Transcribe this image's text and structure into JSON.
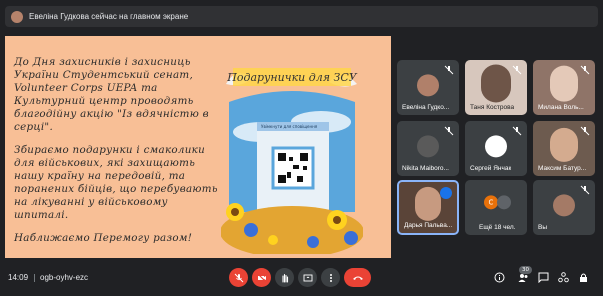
{
  "banner": {
    "text": "Евеліна Гудкова сейчас на главном экране"
  },
  "slide": {
    "paragraphs": [
      "До Дня захисників і захисниць України Студентський сенат, Volunteer Corps UEPA та Культурний центр проводять благодійну акцію \"Із вдячністю в серці\".",
      "Збираємо подарунки і смаколики для військових, які захищають нашу країну на передовій, та поранених бійців, що перебувають на лікуванні у військовому шпиталі.",
      "Наближаємо Перемогу разом!"
    ],
    "image_title": "Подарунички для ЗСУ",
    "phone_caption": "Увімкнути для сповіщення"
  },
  "participants": [
    {
      "name": "Евеліна Гудко...",
      "avatar_color": "#b0806a"
    },
    {
      "name": "Таня Кострова",
      "avatar_color": "#d7c7bd"
    },
    {
      "name": "Милана Воль...",
      "avatar_color": "#c4a79a"
    },
    {
      "name": "Nikita Maiboro...",
      "avatar_color": "#5a5a5a"
    },
    {
      "name": "Сергей Янчак",
      "avatar_color": "#ffffff"
    },
    {
      "name": "Максим Батур...",
      "avatar_color": "#8a6a52"
    },
    {
      "name": "Дарья Пальва...",
      "avatar_color": "#7a5a4a"
    },
    {
      "name": "Ещё 18 чел.",
      "avatar_color": "#e8710a",
      "initial": "С"
    },
    {
      "name": "Вы",
      "avatar_color": "#a47a66"
    }
  ],
  "bottom": {
    "time": "14:09",
    "separator": "|",
    "meeting_code": "ogb-oyhv-ezc",
    "participants_count": "30"
  },
  "colors": {
    "accent": "#8ab4f8",
    "danger": "#ea4335",
    "slide_bg": "#f8bf96"
  },
  "icons": [
    "mic-off-icon",
    "camera-off-icon",
    "raise-hand-icon",
    "present-icon",
    "more-icon",
    "end-call-icon",
    "info-icon",
    "people-icon",
    "chat-icon",
    "activities-icon",
    "lock-icon"
  ]
}
